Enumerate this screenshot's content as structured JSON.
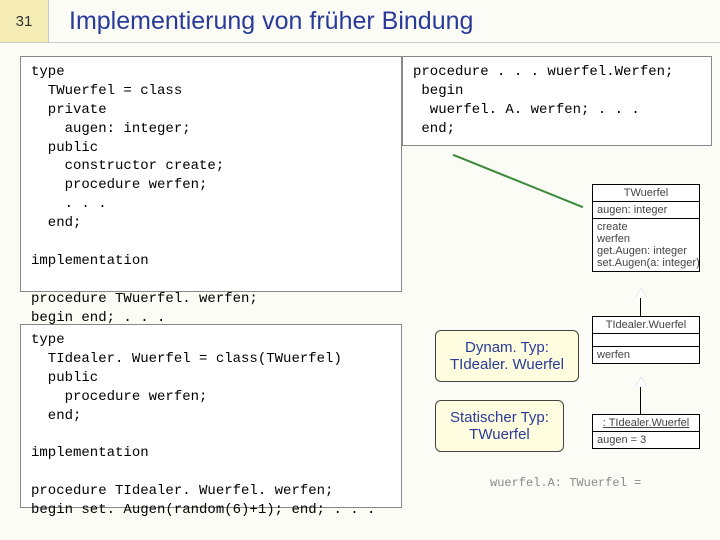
{
  "header": {
    "slide_number": "31",
    "title": "Implementierung von früher Bindung"
  },
  "code_left1": "type\n  TWuerfel = class\n  private\n    augen: integer;\n  public\n    constructor create;\n    procedure werfen;\n    . . .\n  end;\n\nimplementation\n\nprocedure TWuerfel. werfen;\nbegin end; . . .",
  "code_right1": "procedure . . . wuerfel.Werfen;\n begin\n  wuerfel. A. werfen; . . .\n end;",
  "code_left2": "type\n  TIdealer. Wuerfel = class(TWuerfel)\n  public\n    procedure werfen;\n  end;\n\nimplementation\n\nprocedure TIdealer. Wuerfel. werfen;\nbegin set. Augen(random(6)+1); end; . . .",
  "callouts": {
    "dyn": "Dynam. Typ:\nTIdealer. Wuerfel",
    "stat": "Statischer Typ:\nTWuerfel"
  },
  "uml": {
    "class1": {
      "name": "TWuerfel",
      "attrs": "augen: integer",
      "ops": "create\nwerfen\nget.Augen: integer\nset.Augen(a: integer)"
    },
    "class2": {
      "name": "TIdealer.Wuerfel",
      "ops": "werfen"
    },
    "class3": {
      "name": ": TIdealer.Wuerfel",
      "attrs": "augen = 3"
    }
  },
  "decl": "wuerfel.A: TWuerfel ="
}
